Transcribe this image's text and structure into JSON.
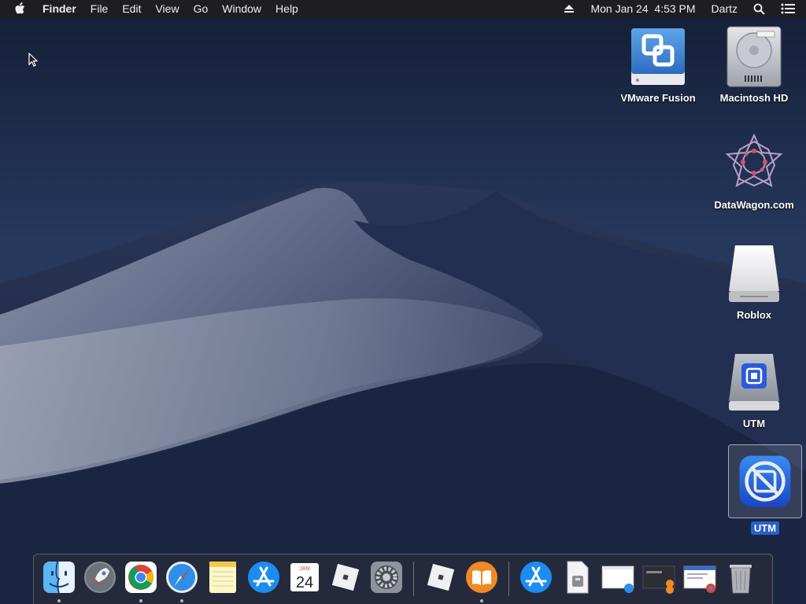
{
  "menubar": {
    "apple_icon": "apple-icon",
    "app_name": "Finder",
    "menus": [
      "File",
      "Edit",
      "View",
      "Go",
      "Window",
      "Help"
    ],
    "clock": "Mon Jan 24  4:53 PM",
    "user": "Dartz",
    "status_icons": [
      "eject-icon",
      "search-icon",
      "notification-center-icon"
    ]
  },
  "desktop": {
    "icons": [
      {
        "label": "VMware Fusion",
        "icon": "vmware-disk-icon"
      },
      {
        "label": "Macintosh HD",
        "icon": "hard-drive-icon"
      },
      {
        "label": "DataWagon.com",
        "icon": "network-star-icon"
      },
      {
        "label": "Roblox",
        "icon": "external-drive-icon"
      },
      {
        "label": "UTM",
        "icon": "utm-disk-icon"
      },
      {
        "label": "UTM",
        "icon": "utm-app-icon",
        "selected": true
      }
    ]
  },
  "dock": {
    "apps": [
      {
        "name": "Finder",
        "icon": "finder-icon",
        "running": true
      },
      {
        "name": "Launchpad",
        "icon": "rocket-icon",
        "running": false
      },
      {
        "name": "Google Chrome",
        "icon": "chrome-icon",
        "running": true
      },
      {
        "name": "Safari",
        "icon": "compass-icon",
        "running": true
      },
      {
        "name": "Notes",
        "icon": "notes-icon",
        "running": false
      },
      {
        "name": "App Store",
        "icon": "app-store-icon",
        "running": false
      },
      {
        "name": "Calendar",
        "icon": "calendar-icon",
        "running": false,
        "month": "JAN",
        "day": "24"
      },
      {
        "name": "Roblox",
        "icon": "roblox-icon",
        "running": false
      },
      {
        "name": "System Preferences",
        "icon": "gear-icon",
        "running": false
      },
      {
        "name": "Roblox Studio",
        "icon": "roblox-icon",
        "running": false
      },
      {
        "name": "Books",
        "icon": "book-icon",
        "running": true
      },
      {
        "name": "App Store Download",
        "icon": "app-store-icon",
        "running": false
      },
      {
        "name": "Archive",
        "icon": "zip-file-icon",
        "running": false
      },
      {
        "name": "Safari Window",
        "icon": "window-thumbnail-icon",
        "running": false
      },
      {
        "name": "Roblox Window",
        "icon": "window-thumbnail-icon",
        "running": false
      },
      {
        "name": "Chrome Window",
        "icon": "window-thumbnail-icon",
        "running": false
      },
      {
        "name": "Trash",
        "icon": "trash-icon",
        "running": false
      }
    ]
  }
}
